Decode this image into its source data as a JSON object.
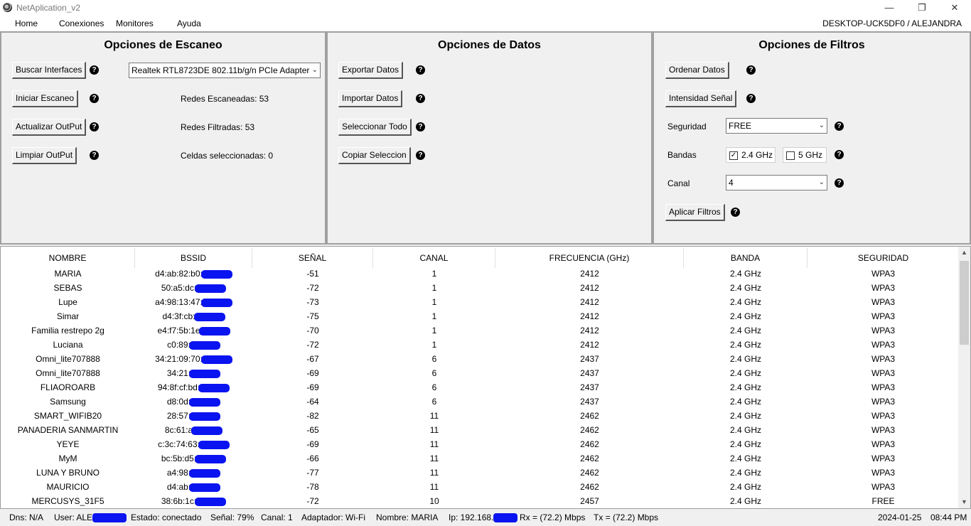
{
  "window": {
    "title": "NetAplication_v2",
    "controls": {
      "minimize": "—",
      "maximize": "❐",
      "close": "✕"
    }
  },
  "menu": {
    "items": [
      "Home",
      "Conexiones",
      "Monitores",
      "Ayuda"
    ],
    "host": "DESKTOP-UCK5DF0 / ALEJANDRA"
  },
  "scan_panel": {
    "title": "Opciones de Escaneo",
    "buttons": [
      "Buscar Interfaces",
      "Iniciar Escaneo",
      "Actualizar OutPut",
      "Limpiar OutPut"
    ],
    "adapter": "Realtek RTL8723DE 802.11b/g/n PCIe Adapter",
    "redes_escaneadas": "Redes Escaneadas: 53",
    "redes_filtradas": "Redes Filtradas: 53",
    "celdas": "Celdas seleccionadas: 0"
  },
  "data_panel": {
    "title": "Opciones de Datos",
    "buttons": [
      "Exportar Datos",
      "Importar Datos",
      "Seleccionar Todo",
      "Copiar Seleccion"
    ]
  },
  "filter_panel": {
    "title": "Opciones de Filtros",
    "ordenar": "Ordenar Datos",
    "intensidad": "Intensidad Señal",
    "seguridad_label": "Seguridad",
    "seguridad_value": "FREE",
    "bandas_label": "Bandas",
    "band_24": {
      "label": "2.4 GHz",
      "checked": true
    },
    "band_5": {
      "label": "5 GHz",
      "checked": false
    },
    "canal_label": "Canal",
    "canal_value": "4",
    "aplicar": "Aplicar Filtros"
  },
  "help_glyph": "?",
  "table": {
    "headers": [
      "NOMBRE",
      "BSSID",
      "SEÑAL",
      "CANAL",
      "FRECUENCIA (GHz)",
      "BANDA",
      "SEGURIDAD"
    ],
    "rows": [
      [
        "MARIA",
        "d4:ab:82:b0:",
        "-51",
        "1",
        "2412",
        "2.4 GHz",
        "WPA3"
      ],
      [
        "SEBAS",
        "50:a5:dc:",
        "-72",
        "1",
        "2412",
        "2.4 GHz",
        "WPA3"
      ],
      [
        "Lupe",
        "a4:98:13:47:",
        "-73",
        "1",
        "2412",
        "2.4 GHz",
        "WPA3"
      ],
      [
        "Simar",
        "d4:3f:cb:",
        "-75",
        "1",
        "2412",
        "2.4 GHz",
        "WPA3"
      ],
      [
        "Familia restrepo 2g",
        "e4:f7:5b:1e",
        "-70",
        "1",
        "2412",
        "2.4 GHz",
        "WPA3"
      ],
      [
        "Luciana",
        "c0:89:",
        "-72",
        "1",
        "2412",
        "2.4 GHz",
        "WPA3"
      ],
      [
        "Omni_lite707888",
        "34:21:09:70:",
        "-67",
        "6",
        "2437",
        "2.4 GHz",
        "WPA3"
      ],
      [
        "Omni_lite707888",
        "34:21:",
        "-69",
        "6",
        "2437",
        "2.4 GHz",
        "WPA3"
      ],
      [
        "FLIAOROARB",
        "94:8f:cf:bd:",
        "-69",
        "6",
        "2437",
        "2.4 GHz",
        "WPA3"
      ],
      [
        "Samsung",
        "d8:0d:",
        "-64",
        "6",
        "2437",
        "2.4 GHz",
        "WPA3"
      ],
      [
        "SMART_WIFIB20",
        "28:57:",
        "-82",
        "11",
        "2462",
        "2.4 GHz",
        "WPA3"
      ],
      [
        "PANADERIA SANMARTIN",
        "8c:61:a",
        "-65",
        "11",
        "2462",
        "2.4 GHz",
        "WPA3"
      ],
      [
        "YEYE",
        "c:3c:74:63:",
        "-69",
        "11",
        "2462",
        "2.4 GHz",
        "WPA3"
      ],
      [
        "MyM",
        "bc:5b:d5:",
        "-66",
        "11",
        "2462",
        "2.4 GHz",
        "WPA3"
      ],
      [
        "LUNA Y BRUNO",
        "a4:98:",
        "-77",
        "11",
        "2462",
        "2.4 GHz",
        "WPA3"
      ],
      [
        "MAURICIO",
        "d4:ab:",
        "-78",
        "11",
        "2462",
        "2.4 GHz",
        "WPA3"
      ],
      [
        "MERCUSYS_31F5",
        "38:6b:1c:",
        "-72",
        "10",
        "2457",
        "2.4 GHz",
        "FREE"
      ]
    ]
  },
  "status": {
    "dns": "Dns: N/A",
    "user": "User: ALE",
    "estado": "Estado: conectado",
    "senal": "Señal: 79%",
    "canal": "Canal: 1",
    "adaptador": "Adaptador: Wi-Fi",
    "nombre": "Nombre: MARIA",
    "ip": "Ip: 192.168.",
    "rx": "Rx = (72.2) Mbps",
    "tx": "Tx = (72.2) Mbps",
    "date": "2024-01-25",
    "time": "08:44 PM"
  }
}
